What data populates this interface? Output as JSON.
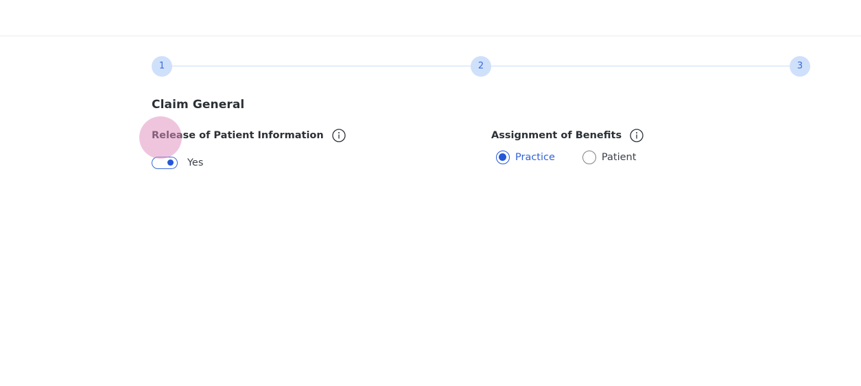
{
  "stepper": {
    "steps": [
      "1",
      "2",
      "3"
    ],
    "current_step": 1
  },
  "claim": {
    "section_title": "Claim General",
    "release": {
      "label": "Release of Patient Information",
      "toggle_on": true,
      "toggle_text": "Yes"
    },
    "assignment": {
      "label": "Assignment of Benefits",
      "options": [
        {
          "label": "Practice",
          "selected": true
        },
        {
          "label": "Patient",
          "selected": false
        }
      ]
    }
  },
  "colors": {
    "accent": "#2456d9",
    "step_fill": "#cfe0fb",
    "click_indicator": "#e08cbe"
  },
  "icons": [
    "info-icon"
  ]
}
